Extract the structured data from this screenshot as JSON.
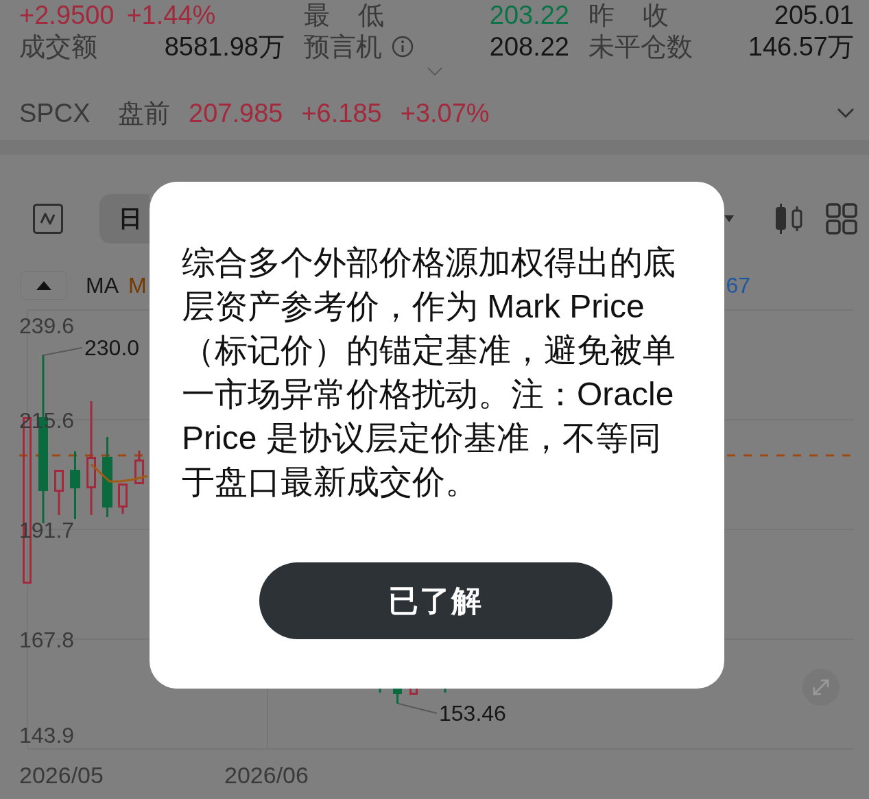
{
  "quote": {
    "change": "+2.9500",
    "change_percent": "+1.44%",
    "up": true
  },
  "stats": [
    {
      "label": "最 低",
      "value": "203.22",
      "color": "#0b7446",
      "info_icon": false
    },
    {
      "label": "昨 收",
      "value": "205.01",
      "color": "#161616",
      "info_icon": false
    },
    {
      "label": "成交额",
      "value": "8581.98万",
      "color": "#161616",
      "info_icon": false
    },
    {
      "label": "预言机",
      "value": "208.22",
      "color": "#161616",
      "info_icon": true
    },
    {
      "label": "未平仓数",
      "value": "146.57万",
      "color": "#161616",
      "info_icon": false
    }
  ],
  "premarket": {
    "label": "SPCX 盘前",
    "price": "207.985",
    "change": "+6.185",
    "change_percent": "+3.07%",
    "up": true
  },
  "chart_toolbar": {
    "period_tab": {
      "label": "日",
      "selected": true
    }
  },
  "indicators": {
    "labels": [
      {
        "text": "MA",
        "color": "#161616"
      },
      {
        "text": "M",
        "color": "#773800"
      }
    ],
    "readout": "67"
  },
  "chart": {
    "y_labels": [
      "239.6",
      "215.6",
      "191.7",
      "167.8",
      "143.9"
    ],
    "x_labels": [
      "2026/05",
      "2026/06"
    ],
    "high_label": "230.0",
    "low_label": "153.46"
  },
  "dialog": {
    "message": "综合多个外部价格源加权得出的底层资产参考价，作为 Mark Price（标记价）的锚定基准，避免被单一市场异常价格扰动。注：Oracle Price 是协议层定价基准，不等同于盘口最新成交价。",
    "button": "已了解"
  }
}
